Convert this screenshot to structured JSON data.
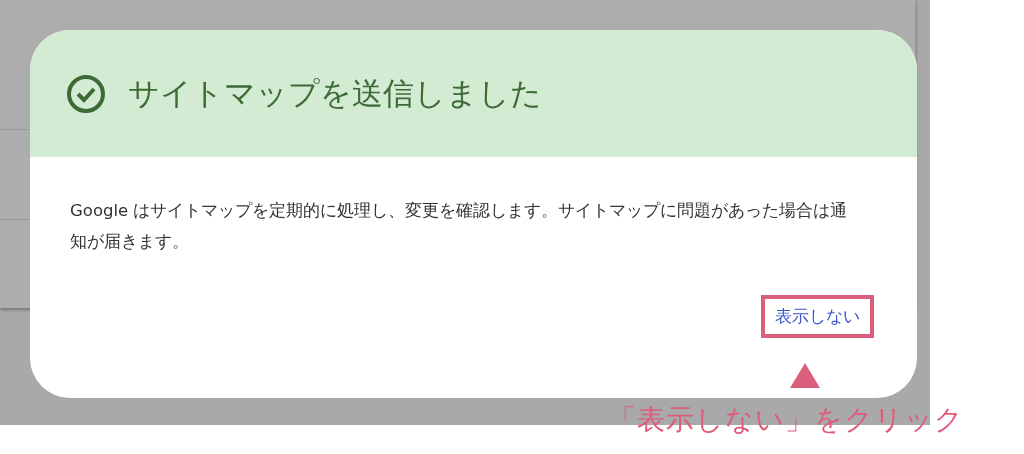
{
  "dialog": {
    "title": "サイトマップを送信しました",
    "body": "Google はサイトマップを定期的に処理し、変更を確認します。サイトマップに問題があった場合は通知が届きます。",
    "button": "表示しない"
  },
  "annotation": {
    "highlighted": true,
    "label": "「表示しない」をクリック"
  }
}
